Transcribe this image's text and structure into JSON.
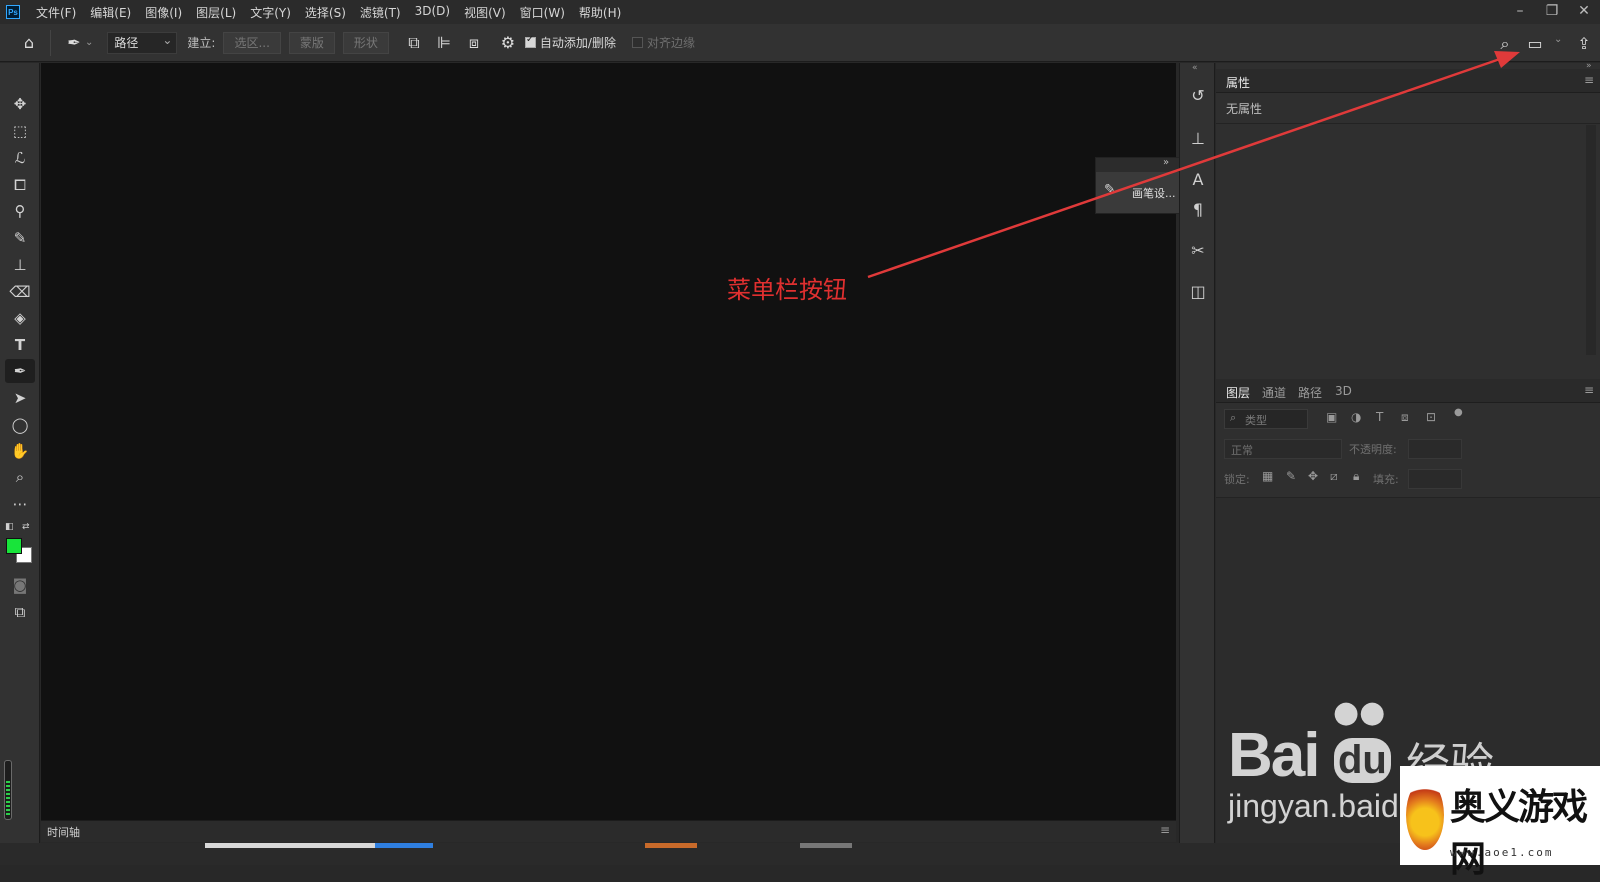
{
  "menubar": {
    "logo": "Ps",
    "items": [
      "文件(F)",
      "编辑(E)",
      "图像(I)",
      "图层(L)",
      "文字(Y)",
      "选择(S)",
      "滤镜(T)",
      "3D(D)",
      "视图(V)",
      "窗口(W)",
      "帮助(H)"
    ]
  },
  "optbar": {
    "mode_value": "路径",
    "make_label": "建立:",
    "selection_btn": "选区...",
    "mask_btn": "蒙版",
    "shape_btn": "形状",
    "auto_add_label": "自动添加/删除",
    "align_edges_label": "对齐边缘"
  },
  "floating_panel": {
    "item_label": "画笔设..."
  },
  "properties": {
    "tab": "属性",
    "empty_text": "无属性"
  },
  "layers": {
    "tabs": [
      "图层",
      "通道",
      "路径",
      "3D"
    ],
    "filter_placeholder": "类型",
    "blend_mode": "正常",
    "opacity_label": "不透明度:",
    "lock_label": "锁定:",
    "fill_label": "填充:"
  },
  "timeline": {
    "label": "时间轴"
  },
  "annotation": {
    "text": "菜单栏按钮",
    "color": "#e03030"
  },
  "colors": {
    "foreground": "#18e43a",
    "background": "#ffffff",
    "accent": "#31a8ff"
  },
  "watermark": {
    "baidu_text": "Bai",
    "baidu_du": "du",
    "baidu_cn": "经验",
    "baidu_url": "jingyan.baidu",
    "site_name": "奥义游戏网",
    "site_url": "www.aoe1.com"
  }
}
